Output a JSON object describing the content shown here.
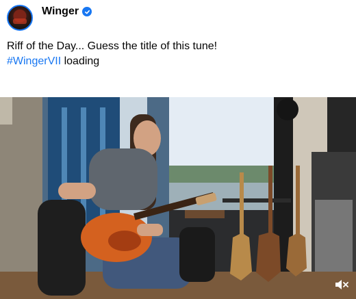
{
  "post": {
    "author": "Winger",
    "text_line1": "Riff of the Day... Guess the title of this tune!",
    "hashtag": "#WingerVII",
    "text_after_hashtag": " loading"
  },
  "icons": {
    "verified": "verified-check-icon",
    "mute": "speaker-muted-icon"
  },
  "colors": {
    "brand_blue": "#1877f2",
    "text": "#050505"
  }
}
